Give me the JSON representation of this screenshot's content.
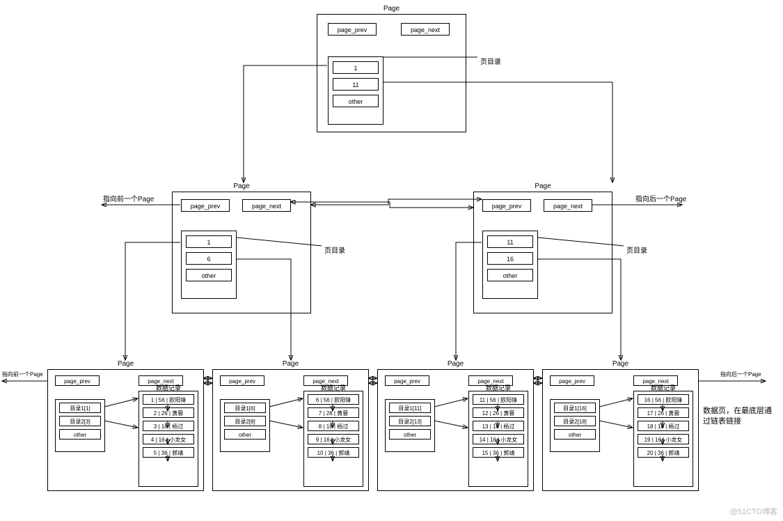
{
  "global": {
    "page_label": "Page",
    "prev": "page_prev",
    "next": "page_next",
    "other": "other",
    "dir_label": "页目录",
    "records_label": "数据记录",
    "prev_ptr": "指向前一个Page",
    "next_ptr": "指向后一个Page",
    "leaf_note": "数据页，在最底层通过链表链接",
    "watermark": "@51CTO博客"
  },
  "root": {
    "slots": [
      "1",
      "11"
    ]
  },
  "mid": [
    {
      "slots": [
        "1",
        "6"
      ]
    },
    {
      "slots": [
        "11",
        "16"
      ]
    }
  ],
  "leaves": [
    {
      "dir": [
        "目录1[1]",
        "目录2[3]"
      ],
      "records": [
        "1 | 56 | 欧阳锋",
        "2 | 26 | 黄蓉",
        "3 | 18 | 杨过",
        "4 | 16 | 小龙女",
        "5 | 36 | 郭靖"
      ]
    },
    {
      "dir": [
        "目录1[6]",
        "目录2[8]"
      ],
      "records": [
        "6 | 56 | 欧阳锋",
        "7 | 26 | 黄蓉",
        "8 | 18 | 杨过",
        "9 | 16 | 小龙女",
        "10 | 36 | 郭靖"
      ]
    },
    {
      "dir": [
        "目录1[11]",
        "目录2[13]"
      ],
      "records": [
        "11 | 56 | 欧阳锋",
        "12 | 26 | 黄蓉",
        "13 | 18 | 杨过",
        "14 | 16 | 小龙女",
        "15 | 36 | 郭靖"
      ]
    },
    {
      "dir": [
        "目录1[16]",
        "目录2[18]"
      ],
      "records": [
        "16 | 56 | 欧阳锋",
        "17 | 26 | 黄蓉",
        "18 | 18 | 杨过",
        "19 | 16 | 小龙女",
        "20 | 36 | 郭靖"
      ]
    }
  ]
}
